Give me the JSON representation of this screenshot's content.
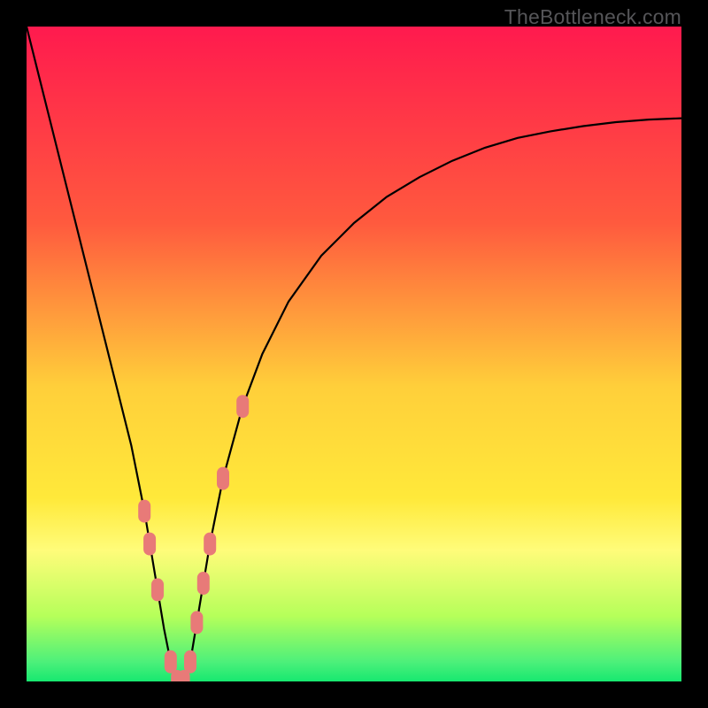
{
  "watermark": "TheBottleneck.com",
  "colors": {
    "frame": "#000000",
    "grad_top": "#ff1a4e",
    "grad_orange": "#ff813b",
    "grad_yellow": "#ffe93a",
    "grad_lightyellow": "#fffc7a",
    "grad_lime": "#b6ff5a",
    "grad_green": "#17e870",
    "curve": "#000000",
    "marker": "#e87a78"
  },
  "chart_data": {
    "type": "line",
    "title": "",
    "xlabel": "",
    "ylabel": "",
    "xlim": [
      0,
      100
    ],
    "ylim": [
      0,
      100
    ],
    "x": [
      0,
      2,
      4,
      6,
      8,
      10,
      12,
      14,
      16,
      18,
      19,
      20,
      21,
      22,
      23,
      24,
      25,
      26,
      27,
      28,
      30,
      33,
      36,
      40,
      45,
      50,
      55,
      60,
      65,
      70,
      75,
      80,
      85,
      90,
      95,
      100
    ],
    "values": [
      100,
      92,
      84,
      76,
      68,
      60,
      52,
      44,
      36,
      26,
      20,
      14,
      8,
      3,
      0,
      0,
      3,
      9,
      15,
      21,
      31,
      42,
      50,
      58,
      65,
      70,
      74,
      77,
      79.5,
      81.5,
      83,
      84,
      84.8,
      85.4,
      85.8,
      86
    ],
    "series": [
      {
        "name": "bottleneck-curve",
        "x": [
          0,
          2,
          4,
          6,
          8,
          10,
          12,
          14,
          16,
          18,
          19,
          20,
          21,
          22,
          23,
          24,
          25,
          26,
          27,
          28,
          30,
          33,
          36,
          40,
          45,
          50,
          55,
          60,
          65,
          70,
          75,
          80,
          85,
          90,
          95,
          100
        ],
        "y": [
          100,
          92,
          84,
          76,
          68,
          60,
          52,
          44,
          36,
          26,
          20,
          14,
          8,
          3,
          0,
          0,
          3,
          9,
          15,
          21,
          31,
          42,
          50,
          58,
          65,
          70,
          74,
          77,
          79.5,
          81.5,
          83,
          84,
          84.8,
          85.4,
          85.8,
          86
        ]
      }
    ],
    "markers": {
      "shape": "rounded-rect",
      "color": "#e87a78",
      "points_index": [
        13,
        14,
        15,
        16,
        17,
        18,
        19,
        20,
        21
      ],
      "extra_left": [
        {
          "x": 18.0,
          "y": 26
        },
        {
          "x": 18.8,
          "y": 21
        },
        {
          "x": 20.0,
          "y": 14
        }
      ]
    },
    "gradient_stops": [
      {
        "pos": 0.0,
        "color": "#ff1a4e"
      },
      {
        "pos": 0.3,
        "color": "#ff5a3e"
      },
      {
        "pos": 0.55,
        "color": "#ffcf3a"
      },
      {
        "pos": 0.72,
        "color": "#ffe93a"
      },
      {
        "pos": 0.8,
        "color": "#fffc7a"
      },
      {
        "pos": 0.9,
        "color": "#b6ff5a"
      },
      {
        "pos": 0.97,
        "color": "#4df07a"
      },
      {
        "pos": 1.0,
        "color": "#17e870"
      }
    ]
  }
}
